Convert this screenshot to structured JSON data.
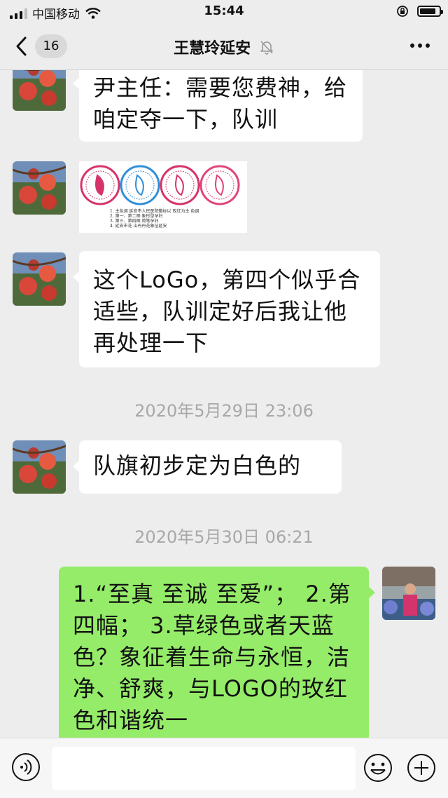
{
  "status_bar": {
    "carrier": "中国移动",
    "time": "15:44",
    "battery_level": 0.85
  },
  "nav": {
    "back_count": "16",
    "title": "王慧玲延安"
  },
  "messages": [
    {
      "side": "left",
      "text": "尹主任：需要您费神，给咱定夺一下，队训"
    },
    {
      "side": "left",
      "type": "image"
    },
    {
      "side": "left",
      "text": "这个LoGo，第四个似乎合适些，队训定好后我让他再处理一下"
    },
    {
      "type": "time",
      "text": "2020年5月29日 23:06"
    },
    {
      "side": "left",
      "text": "队旗初步定为白色的"
    },
    {
      "type": "time",
      "text": "2020年5月30日 06:21"
    },
    {
      "side": "right",
      "text": "1.“至真 至诚 至爱”； 2.第四幅； 3.草绿色或者天蓝色？象征着生命与永恒，洁净、舒爽，与LOGO的玫红色和谐统一"
    }
  ],
  "logo_image": {
    "caption_lines": [
      "1. 主色调 延安市人民医院徽标以 玫红为主 色调",
      "2. 第一、第二图 象形型孕妇",
      "3. 第三、第四图 简笔孕妇",
      "4. 延安市花 山丹丹花象征延安"
    ],
    "colors": [
      "#d6336c",
      "#2f8fd8",
      "#d6336c",
      "#e0457b"
    ]
  },
  "input": {
    "placeholder": ""
  },
  "colors": {
    "background": "#ededed",
    "bubble_in": "#ffffff",
    "bubble_out": "#95ec69"
  }
}
